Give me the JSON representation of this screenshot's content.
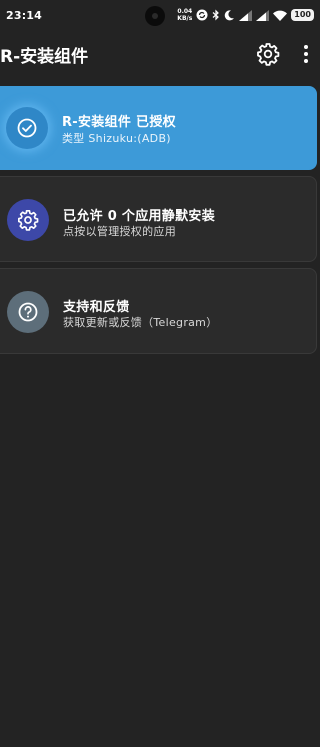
{
  "status_bar": {
    "time": "23:14",
    "net_speed_value": "0.04",
    "net_speed_unit": "KB/s",
    "battery": "100"
  },
  "app_bar": {
    "title": "R-安装组件"
  },
  "cards": {
    "status": {
      "title": "R-安装组件 已授权",
      "subtitle": "类型 Shizuku:(ADB)",
      "icon": "check-circle-icon",
      "color": "#3d9ad8"
    },
    "apps": {
      "title": "已允许 0 个应用静默安装",
      "subtitle": "点按以管理授权的应用",
      "icon": "gear-icon",
      "color": "#3d48a8"
    },
    "support": {
      "title": "支持和反馈",
      "subtitle": "获取更新或反馈（Telegram）",
      "icon": "help-circle-icon",
      "color": "#5d6e7a"
    }
  }
}
